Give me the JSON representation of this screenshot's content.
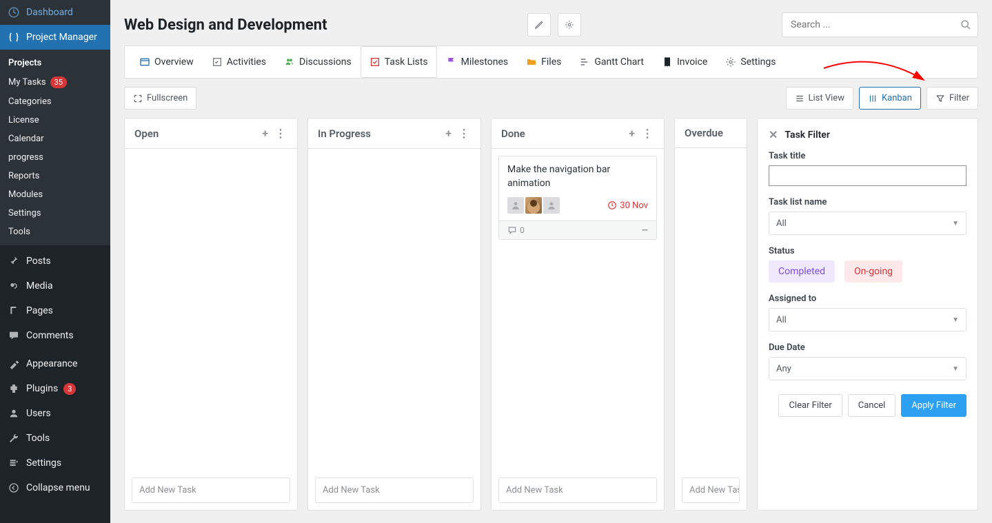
{
  "sidebar": {
    "dashboard": "Dashboard",
    "project_manager": "Project Manager",
    "submenu": {
      "heading": "Projects",
      "my_tasks": "My Tasks",
      "my_tasks_badge": "35",
      "categories": "Categories",
      "license": "License",
      "calendar": "Calendar",
      "progress": "progress",
      "reports": "Reports",
      "modules": "Modules",
      "settings": "Settings",
      "tools": "Tools"
    },
    "posts": "Posts",
    "media": "Media",
    "pages": "Pages",
    "comments": "Comments",
    "appearance": "Appearance",
    "plugins": "Plugins",
    "plugins_badge": "3",
    "users": "Users",
    "tools": "Tools",
    "settings": "Settings",
    "collapse": "Collapse menu"
  },
  "header": {
    "title": "Web Design and Development",
    "search_placeholder": "Search ..."
  },
  "tabs": {
    "overview": "Overview",
    "activities": "Activities",
    "discussions": "Discussions",
    "task_lists": "Task Lists",
    "milestones": "Milestones",
    "files": "Files",
    "gantt": "Gantt Chart",
    "invoice": "Invoice",
    "settings": "Settings"
  },
  "toolbar": {
    "fullscreen": "Fullscreen",
    "list_view": "List View",
    "kanban": "Kanban",
    "filter": "Filter"
  },
  "columns": {
    "open": "Open",
    "in_progress": "In Progress",
    "done": "Done",
    "overdue": "Overdue",
    "add_task": "Add New Task"
  },
  "card": {
    "title": "Make the navigation bar animation",
    "due": "30 Nov",
    "comments": "0"
  },
  "filter_panel": {
    "title": "Task Filter",
    "task_title_label": "Task title",
    "task_list_label": "Task list name",
    "task_list_value": "All",
    "status_label": "Status",
    "status_completed": "Completed",
    "status_ongoing": "On-going",
    "assigned_label": "Assigned to",
    "assigned_value": "All",
    "due_label": "Due Date",
    "due_value": "Any",
    "clear": "Clear Filter",
    "cancel": "Cancel",
    "apply": "Apply Filter"
  }
}
